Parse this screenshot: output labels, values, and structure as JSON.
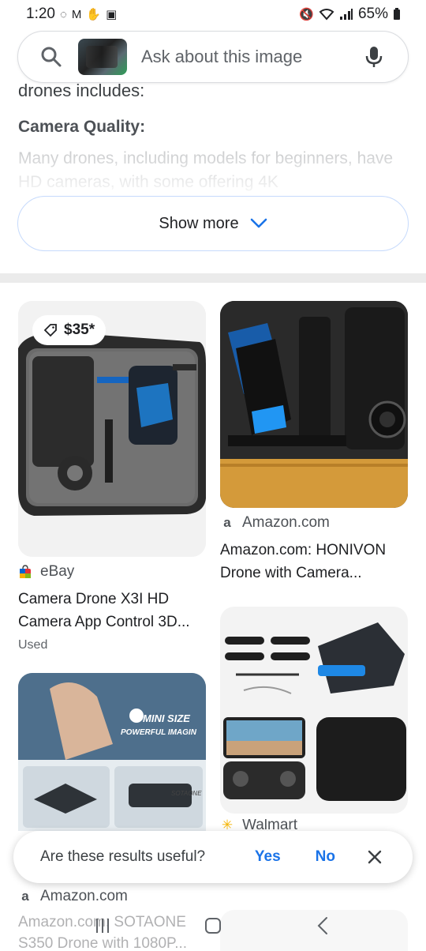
{
  "status_bar": {
    "time": "1:20",
    "left_icons": [
      "whatsapp-icon",
      "gmail-icon",
      "hand-icon",
      "gallery-icon"
    ],
    "right_icons": [
      "mute-icon",
      "wifi-icon",
      "signal-icon",
      "battery-icon"
    ],
    "battery": "65%"
  },
  "search": {
    "placeholder": "Ask about this image"
  },
  "answer": {
    "cut_line": "drones includes:",
    "heading": "Camera Quality:",
    "fade_text": "Many drones, including models for beginners, have HD cameras, with some offering 4K"
  },
  "show_more": {
    "label": "Show more"
  },
  "results": [
    {
      "price": "$35*",
      "source": "eBay",
      "title": "Camera Drone X3I HD Camera App Control 3D...",
      "sub": "Used"
    },
    {
      "source": "Amazon.com",
      "title": "Amazon.com: HONIVON Drone with Camera..."
    },
    {
      "image_text_1": "MINI SIZE",
      "image_text_2": "POWERFUL IMAGIN",
      "image_text_3": "SOTAONE"
    },
    {
      "source": "Walmart"
    }
  ],
  "feedback": {
    "question": "Are these results useful?",
    "yes": "Yes",
    "no": "No"
  },
  "bottom": {
    "source": "Amazon.com",
    "title": "Amazon.com: SOTAONE S350 Drone with 1080P..."
  },
  "colors": {
    "accent": "#1a73e8",
    "divider": "#ebebeb"
  }
}
